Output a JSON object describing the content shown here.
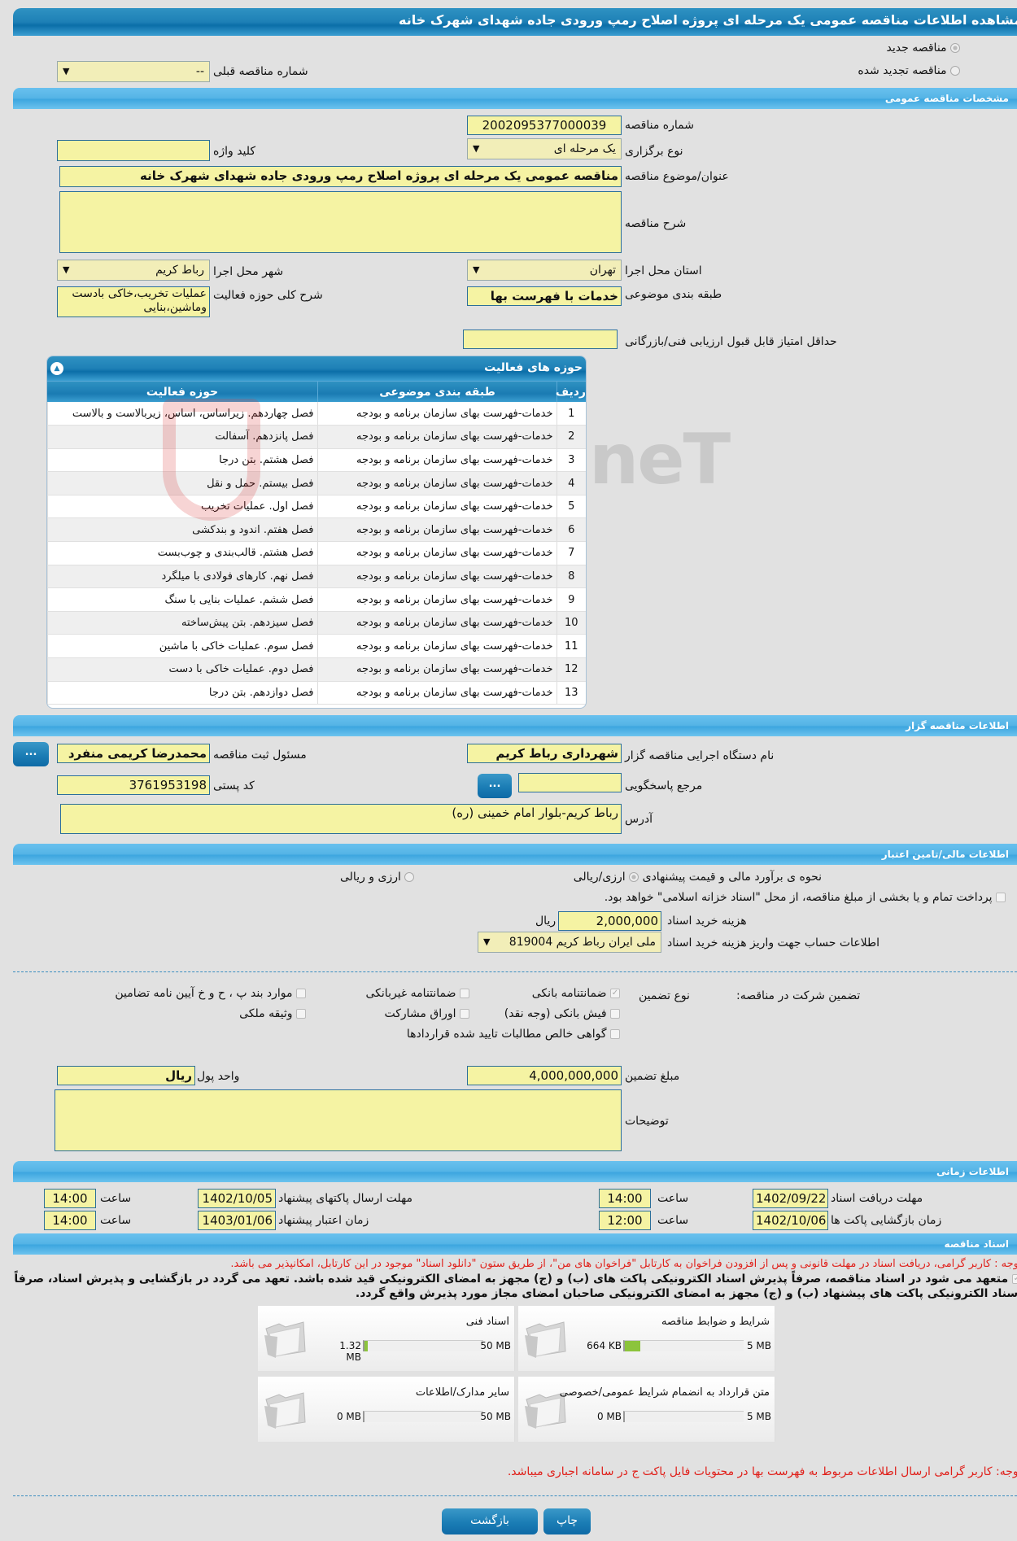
{
  "header": {
    "title": "مشاهده اطلاعات مناقصه عمومی یک مرحله ای پروژه اصلاح رمپ ورودی جاده شهدای شهرک خانه"
  },
  "tender_type": {
    "options": [
      {
        "label": "مناقصه جدید",
        "selected": true
      },
      {
        "label": "مناقصه تجدید شده",
        "selected": false
      }
    ],
    "previous_number_label": "شماره مناقصه قبلی",
    "previous_number_value": "--"
  },
  "general": {
    "section_title": "مشخصات مناقصه عمومی",
    "tender_number_label": "شماره مناقصه",
    "tender_number": "2002095377000039",
    "holding_type_label": "نوع برگزاری",
    "holding_type": "یک مرحله ای",
    "keyword_label": "کلید واژه",
    "keyword": "",
    "subject_label": "عنوان/موضوع مناقصه",
    "subject": "مناقصه عمومی یک مرحله ای پروژه اصلاح رمپ ورودی جاده شهدای شهرک خانه",
    "description_label": "شرح مناقصه",
    "description": "",
    "province_label": "استان محل اجرا",
    "province": "تهران",
    "city_label": "شهر محل اجرا",
    "city": "رباط کریم",
    "category_label": "طبقه بندی موضوعی",
    "category": "خدمات با فهرست بها",
    "activity_desc_label": "شرح کلی حوزه فعالیت",
    "activity_desc": "عملیات تخریب،خاکی بادست وماشین،بنایی",
    "min_score_label": "حداقل امتیاز قابل قبول ارزیابی فنی/بازرگانی",
    "min_score": ""
  },
  "activities": {
    "title": "حوزه های فعالیت",
    "columns": [
      "ردیف",
      "طبقه بندی موضوعی",
      "حوزه فعالیت"
    ],
    "rows": [
      {
        "no": "1",
        "category": "خدمات-فهرست بهای سازمان برنامه و بودجه",
        "activity": "فصل چهاردهم. زیراساس، اساس، زیربالاست و بالاست"
      },
      {
        "no": "2",
        "category": "خدمات-فهرست بهای سازمان برنامه و بودجه",
        "activity": "فصل پانزدهم. آسفالت"
      },
      {
        "no": "3",
        "category": "خدمات-فهرست بهای سازمان برنامه و بودجه",
        "activity": "فصل هشتم. بتن درجا"
      },
      {
        "no": "4",
        "category": "خدمات-فهرست بهای سازمان برنامه و بودجه",
        "activity": "فصل بیستم. حمل و نقل"
      },
      {
        "no": "5",
        "category": "خدمات-فهرست بهای سازمان برنامه و بودجه",
        "activity": "فصل اول. عملیات تخریب"
      },
      {
        "no": "6",
        "category": "خدمات-فهرست بهای سازمان برنامه و بودجه",
        "activity": "فصل هفتم. اندود و بندکشی"
      },
      {
        "no": "7",
        "category": "خدمات-فهرست بهای سازمان برنامه و بودجه",
        "activity": "فصل هشتم. قالب‌بندی و چوب‌بست"
      },
      {
        "no": "8",
        "category": "خدمات-فهرست بهای سازمان برنامه و بودجه",
        "activity": "فصل نهم. کارهای فولادی با میلگرد"
      },
      {
        "no": "9",
        "category": "خدمات-فهرست بهای سازمان برنامه و بودجه",
        "activity": "فصل ششم. عملیات بنایی با سنگ"
      },
      {
        "no": "10",
        "category": "خدمات-فهرست بهای سازمان برنامه و بودجه",
        "activity": "فصل سیزدهم. بتن پیش‌ساخته"
      },
      {
        "no": "11",
        "category": "خدمات-فهرست بهای سازمان برنامه و بودجه",
        "activity": "فصل سوم. عملیات خاکی با ماشین"
      },
      {
        "no": "12",
        "category": "خدمات-فهرست بهای سازمان برنامه و بودجه",
        "activity": "فصل دوم. عملیات خاکی با دست"
      },
      {
        "no": "13",
        "category": "خدمات-فهرست بهای سازمان برنامه و بودجه",
        "activity": "فصل دوازدهم. بتن درجا"
      }
    ]
  },
  "watermark": "AriaTender.neT",
  "organizer": {
    "section_title": "اطلاعات مناقصه گزار",
    "org_name_label": "نام دستگاه اجرایی مناقصه گزار",
    "org_name": "شهرداری رباط کریم",
    "registrar_label": "مسئول ثبت مناقصه",
    "registrar": "محمدرضا کریمی منفرد",
    "reference_label": "مرجع پاسخگویی",
    "reference": "",
    "postal_code_label": "کد پستی",
    "postal_code": "3761953198",
    "address_label": "آدرس",
    "address": "رباط کریم-بلوار امام خمینی (ره)",
    "lookup_button": "..."
  },
  "finance": {
    "section_title": "اطلاعات مالی/تامین اعتبار",
    "estimate_label": "نحوه ی برآورد مالی و قیمت پیشنهادی",
    "estimate_options": [
      {
        "label": "ارزی/ریالی",
        "selected": true
      },
      {
        "label": "ارزی و ریالی",
        "selected": false
      }
    ],
    "treasury_note": "پرداخت تمام و یا بخشی از مبلغ مناقصه، از محل \"اسناد خزانه اسلامی\" خواهد بود.",
    "doc_fee_label": "هزینه خرید اسناد",
    "doc_fee": "2,000,000",
    "doc_fee_unit": "ریال",
    "account_label": "اطلاعات حساب جهت واریز هزینه خرید اسناد",
    "account": "ملی ایران رباط کریم 819004"
  },
  "guarantee": {
    "label": "تضمین شرکت در مناقصه:",
    "type_label": "نوع تضمین",
    "options": [
      {
        "label": "ضمانتنامه بانکی",
        "checked": true
      },
      {
        "label": "ضمانتنامه غیربانکی",
        "checked": false
      },
      {
        "label": "موارد بند پ ، ح و خ آیین نامه تضامین",
        "checked": false
      },
      {
        "label": "فیش بانکی (وجه نقد)",
        "checked": false
      },
      {
        "label": "اوراق مشارکت",
        "checked": false
      },
      {
        "label": "وثیقه ملکی",
        "checked": false
      },
      {
        "label": "گواهی خالص مطالبات تایید شده قراردادها",
        "checked": false
      }
    ],
    "amount_label": "مبلغ تضمین",
    "amount": "4,000,000,000",
    "currency_label": "واحد پول",
    "currency": "ریال",
    "notes_label": "توضیحات",
    "notes": ""
  },
  "timing": {
    "section_title": "اطلاعات زمانی",
    "hour_label": "ساعت",
    "doc_deadline_label": "مهلت دریافت اسناد",
    "doc_deadline_date": "1402/09/22",
    "doc_deadline_time": "14:00",
    "submit_deadline_label": "مهلت ارسال پاکتهای پیشنهاد",
    "submit_deadline_date": "1402/10/05",
    "submit_deadline_time": "14:00",
    "opening_label": "زمان بازگشایی پاکت ها",
    "opening_date": "1402/10/06",
    "opening_time": "12:00",
    "validity_label": "زمان اعتبار پیشنهاد",
    "validity_date": "1403/01/06",
    "validity_time": "14:00"
  },
  "documents": {
    "section_title": "اسناد مناقصه",
    "notice": "توجه : کاربر گرامی، دریافت اسناد در مهلت قانونی و پس از افزودن فراخوان به کارتابل \"فراخوان های من\"، از طریق ستون \"دانلود اسناد\" موجود در این کارتابل، امکانپذیر می باشد.",
    "commitment": "متعهد می شود در اسناد مناقصه، صرفاً پذیرش اسناد الکترونیکی پاکت های (ب) و (ج) مجهز به امضای الکترونیکی قید شده باشد. تعهد می گردد در بازگشایی و پذیرش اسناد، صرفاً اسناد الکترونیکی پاکت های پیشنهاد (ب) و (ج) مجهز به امضای الکترونیکی صاحبان امضای مجاز مورد پذیرش واقع گردد.",
    "commitment_checked": true,
    "files": [
      {
        "title": "شرایط و ضوابط مناقصه",
        "current": "664 KB",
        "max": "5 MB",
        "fill_fraction": 0.13
      },
      {
        "title": "اسناد فنی",
        "current": "1.32 MB",
        "max": "50 MB",
        "fill_fraction": 0.026
      },
      {
        "title": "متن قرارداد به انضمام شرایط عمومی/خصوصی",
        "current": "0 MB",
        "max": "5 MB",
        "fill_fraction": 0
      },
      {
        "title": "سایر مدارک/اطلاعات",
        "current": "0 MB",
        "max": "50 MB",
        "fill_fraction": 0
      }
    ],
    "price_list_notice": "توجه: کاربر گرامی ارسال اطلاعات مربوط به فهرست بها در محتویات فایل پاکت ج در سامانه اجباری میباشد."
  },
  "footer": {
    "print_label": "چاپ",
    "back_label": "بازگشت"
  }
}
